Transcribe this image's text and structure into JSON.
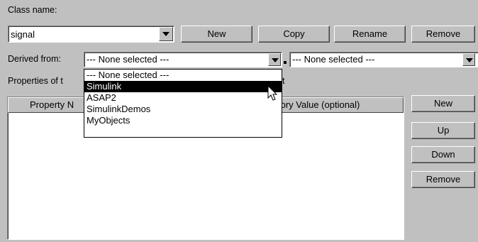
{
  "class_name_label": "Class name:",
  "class_name_value": "signal",
  "buttons_top": {
    "new": "New",
    "copy": "Copy",
    "rename": "Rename",
    "remove": "Remove"
  },
  "derived_from_label": "Derived from:",
  "derived_combo_1": "--- None selected ---",
  "derived_combo_2": "--- None selected ---",
  "properties_label": "Properties of t",
  "properties_label_tail": "t",
  "table_headers": {
    "property_name": "Property N",
    "factory_value": "tory Value (optional)"
  },
  "dropdown_items": [
    "--- None selected ---",
    "Simulink",
    "ASAP2",
    "SimulinkDemos",
    "MyObjects"
  ],
  "dropdown_selected_index": 1,
  "buttons_side": {
    "new": "New",
    "up": "Up",
    "down": "Down",
    "remove": "Remove"
  }
}
